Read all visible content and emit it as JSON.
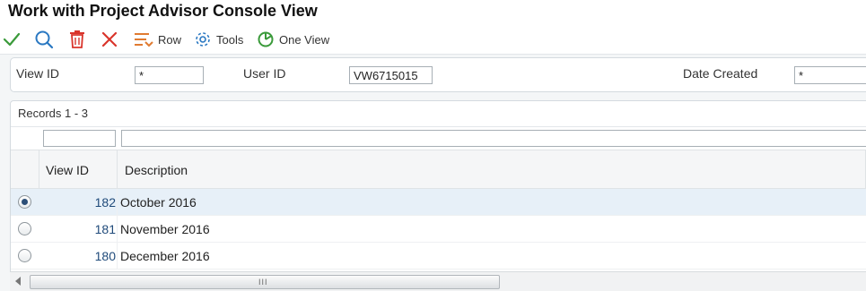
{
  "window": {
    "title": "Work with Project Advisor Console View"
  },
  "toolbar": {
    "row_label": "Row",
    "tools_label": "Tools",
    "oneview_label": "One View"
  },
  "filter": {
    "view_id_label": "View ID",
    "view_id_value": "*",
    "user_id_label": "User ID",
    "user_id_value": "VW6715015",
    "date_created_label": "Date Created",
    "date_created_value": "*"
  },
  "grid": {
    "records_label": "Records 1 - 3",
    "columns": [
      "View ID",
      "Description"
    ],
    "rows": [
      {
        "view_id": "182",
        "description": "October 2016",
        "selected": true
      },
      {
        "view_id": "181",
        "description": "November 2016",
        "selected": false
      },
      {
        "view_id": "180",
        "description": "December 2016",
        "selected": false
      }
    ]
  },
  "scrollbar": {
    "grip": "III"
  },
  "colors": {
    "check_icon": "#3a9a3a",
    "search_icon": "#2a78c2",
    "delete_icon": "#d9342b",
    "close_icon": "#d9342b",
    "row_icon": "#e07a30",
    "tools_icon": "#2a78c2",
    "oneview_icon": "#3a9a3a",
    "selected_row": "#e7f0f8",
    "view_id_text": "#1f4a7a"
  }
}
